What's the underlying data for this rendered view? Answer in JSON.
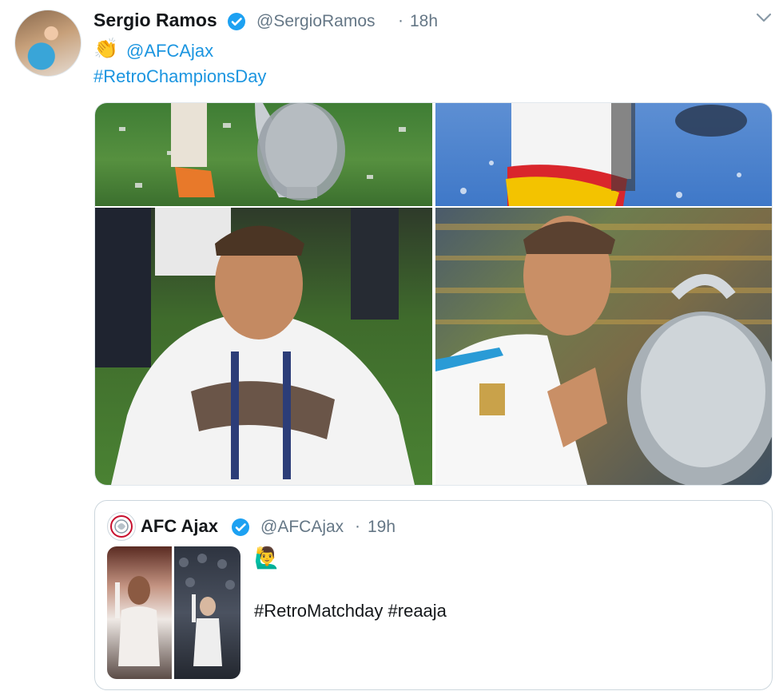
{
  "tweet": {
    "author_name": "Sergio Ramos",
    "author_handle": "@SergioRamos",
    "time_separator": "·",
    "time": "18h",
    "emoji": "👏",
    "mention": "@AFCAjax",
    "hashtag": "#RetroChampionsDay",
    "photos": [
      "photo-1",
      "photo-2",
      "photo-3",
      "photo-4"
    ]
  },
  "quoted_tweet": {
    "author_name": "AFC Ajax",
    "author_handle": "@AFCAjax",
    "time_separator": "·",
    "time": "19h",
    "emoji": "🙋‍♂️",
    "hashtags": "#RetroMatchday #reaaja"
  },
  "icons": {
    "verified": "verified-badge-icon",
    "menu": "chevron-down-icon"
  },
  "colors": {
    "link": "#1b95e0",
    "secondary_text": "#657786",
    "verified": "#1da1f2"
  }
}
